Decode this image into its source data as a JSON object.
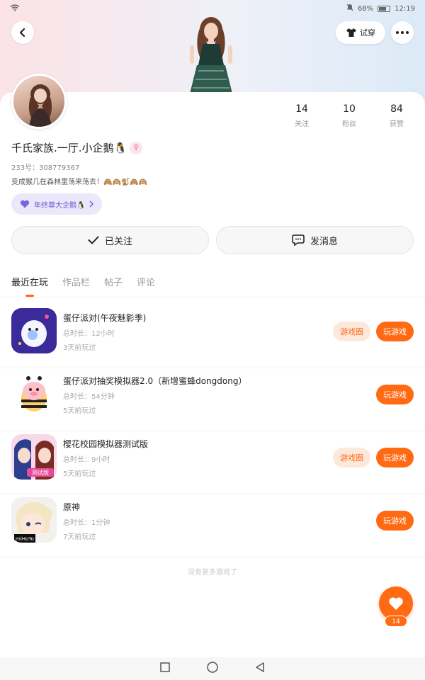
{
  "status_bar": {
    "battery": "68%",
    "time": "12:19"
  },
  "header": {
    "try_on_label": "试穿"
  },
  "profile": {
    "stats": [
      {
        "num": "14",
        "label": "关注"
      },
      {
        "num": "10",
        "label": "粉丝"
      },
      {
        "num": "84",
        "label": "获赞"
      }
    ],
    "name": "千氏家族.一厅.小企鹅🐧",
    "uid": "233号：308779367",
    "bio": "变成猴几在森林里荡来荡去！🙈🙉🐒🙈🙉",
    "tag": "年终尊大企鹅🐧"
  },
  "actions": {
    "follow_label": "已关注",
    "message_label": "发消息"
  },
  "tabs": [
    "最近在玩",
    "作品栏",
    "帖子",
    "评论"
  ],
  "games": [
    {
      "title": "蛋仔派对(午夜魅影季)",
      "duration": "总时长：12小时",
      "last_played": "3天前玩过",
      "circle_label": "游戏圈",
      "play_label": "玩游戏"
    },
    {
      "title": "蛋仔派对抽奖模拟器2.0（新增蜜蜂dongdong）",
      "duration": "总时长：54分钟",
      "last_played": "5天前玩过",
      "play_label": "玩游戏"
    },
    {
      "title": "樱花校园模拟器测试版",
      "duration": "总时长：9小时",
      "last_played": "5天前玩过",
      "circle_label": "游戏圈",
      "play_label": "玩游戏",
      "icon_text": "测试版"
    },
    {
      "title": "原神",
      "duration": "总时长：1分钟",
      "last_played": "7天前玩过",
      "play_label": "玩游戏",
      "icon_text": "miHoYo"
    }
  ],
  "no_more_text": "没有更多游戏了",
  "like_count": "14",
  "colors": {
    "accent": "#ff6a13",
    "tag_bg": "#ece8fb",
    "tag_fg": "#6a57d6"
  }
}
